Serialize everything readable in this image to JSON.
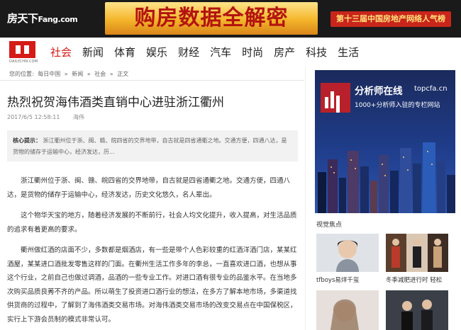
{
  "banner": {
    "brand": "房天下",
    "brand_domain": "Fang.com",
    "headline": "购房数据全解密",
    "tag": "第十三届中国房地产网络人气榜"
  },
  "site": {
    "logo_domain": "DAILYCHN.COM"
  },
  "nav": {
    "items": [
      {
        "label": "社会",
        "active": true
      },
      {
        "label": "新闻"
      },
      {
        "label": "体育"
      },
      {
        "label": "娱乐"
      },
      {
        "label": "财经"
      },
      {
        "label": "汽车"
      },
      {
        "label": "时尚"
      },
      {
        "label": "房产"
      },
      {
        "label": "科技"
      },
      {
        "label": "生活"
      }
    ]
  },
  "breadcrumb": {
    "location_label": "您的位置:",
    "items": [
      "每日中国",
      "新闻",
      "社会",
      "正文"
    ],
    "separator": "»"
  },
  "article": {
    "title": "热烈祝贺海伟酒类直销中心进驻浙江衢州",
    "datetime": "2017/6/5 12:58:11",
    "source": "海伟",
    "summary_label": "核心提示：",
    "summary": "浙江衢州位于浙、闽、赣、皖四省的交界地带，自古就是四省通衢之地。交通方便，四通八达，是货物的储存于运输中心，经济发达，历...",
    "paragraphs": [
      "浙江衢州位于浙、闽、赣、皖四省的交界地带，自古就是四省通衢之地。交通方便，四通八达，是货物的储存于运输中心，经济发达，历史文化悠久，名人辈出。",
      "这个物华天宝的地方，随着经济发展的不断前行，社会人均文化提升，收入提高，对生活品质的追求有着更高的要求。",
      "衢州做红酒的店面不少，多数都是烟酒店，有一些是带个人色彩较重的红酒洋酒门店，某某红酒屋，某某进口酒批发零售这样的门面。在衢州生活工作多年的李总，一直喜欢进口酒，也想从事这个行业，之前自己也做过调酒，品酒的一些专业工作。对进口酒有很专业的品鉴水平。在当地多次购买品质良莠不齐的产品。所以萌生了投资进口酒行业的想法，在多方了解本地市场，多渠道找供货商的过程中，了解到了海伟酒类交易市场。对海伟酒类交易市场的改变交易点在中国保税区，实行上下游会员制的模式非常认可。"
    ]
  },
  "sidebar": {
    "ad": {
      "name": "分析师在线",
      "url": "topcfa.cn",
      "desc": "1000+分析师入驻的专栏网站"
    },
    "section_title": "视觉焦点",
    "items": [
      {
        "caption": "tfboys易烊千玺"
      },
      {
        "caption": "冬季减肥进行时 轻松"
      }
    ]
  }
}
